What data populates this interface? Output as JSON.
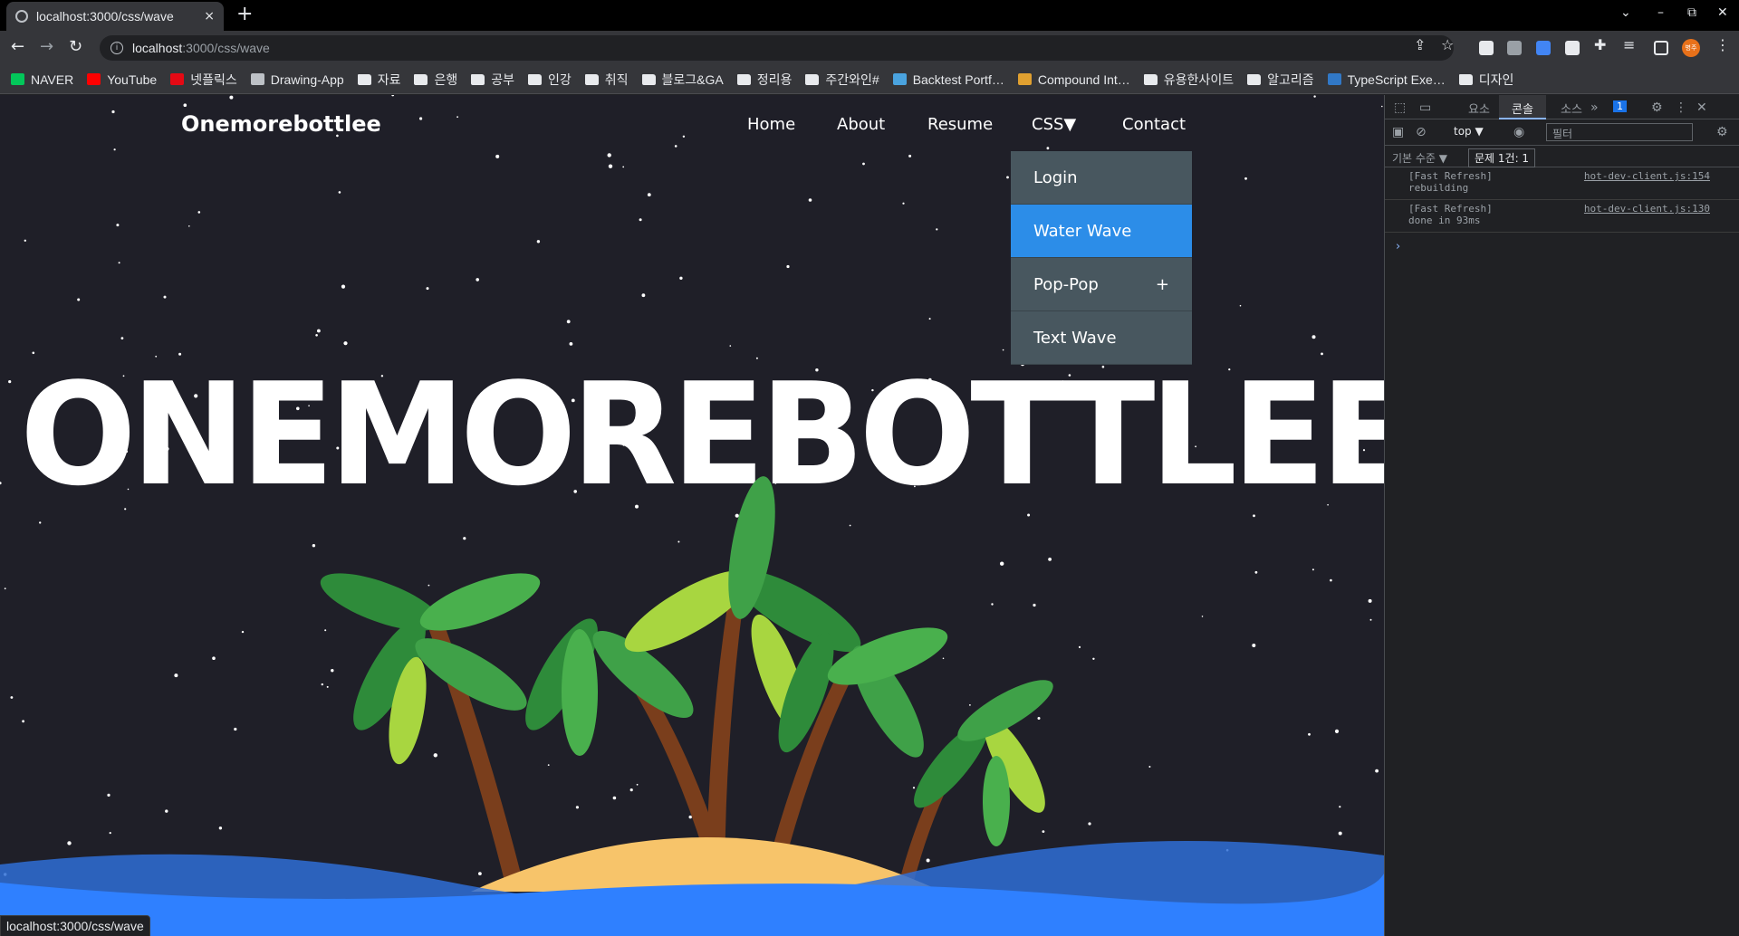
{
  "browser": {
    "tab_title": "localhost:3000/css/wave",
    "tab_close": "×",
    "new_tab": "+",
    "window_controls": [
      "⌄",
      "–",
      "⧉",
      "✕"
    ],
    "url_host": "localhost",
    "url_path": ":3000/css/wave",
    "status_url": "localhost:3000/css/wave"
  },
  "bookmarks": [
    {
      "label": "NAVER",
      "icon": "naver-icon",
      "color": "#03c75a"
    },
    {
      "label": "YouTube",
      "icon": "youtube-icon",
      "color": "#ff0000"
    },
    {
      "label": "넷플릭스",
      "icon": "netflix-icon",
      "color": "#e50914"
    },
    {
      "label": "Drawing-App",
      "icon": "globe-icon",
      "color": "#bdc1c6"
    },
    {
      "label": "자료",
      "icon": "folder-icon"
    },
    {
      "label": "은행",
      "icon": "folder-icon"
    },
    {
      "label": "공부",
      "icon": "folder-icon"
    },
    {
      "label": "인강",
      "icon": "folder-icon"
    },
    {
      "label": "취직",
      "icon": "folder-icon"
    },
    {
      "label": "블로그&GA",
      "icon": "folder-icon"
    },
    {
      "label": "정리용",
      "icon": "folder-icon"
    },
    {
      "label": "주간와인#",
      "icon": "folder-icon"
    },
    {
      "label": "Backtest Portf…",
      "icon": "site-icon",
      "color": "#4aa3df"
    },
    {
      "label": "Compound Int…",
      "icon": "site-icon",
      "color": "#e0a030"
    },
    {
      "label": "유용한사이트",
      "icon": "folder-icon"
    },
    {
      "label": "알고리즘",
      "icon": "folder-icon"
    },
    {
      "label": "TypeScript Exe…",
      "icon": "typescript-icon",
      "color": "#3178c6"
    },
    {
      "label": "디자인",
      "icon": "folder-icon"
    }
  ],
  "site": {
    "logo": "Onemorebottlee",
    "nav": [
      "Home",
      "About",
      "Resume",
      "CSS▼",
      "Contact"
    ],
    "dropdown": [
      {
        "label": "Login",
        "extra": ""
      },
      {
        "label": "Water Wave",
        "extra": ""
      },
      {
        "label": "Pop-Pop",
        "extra": "+"
      },
      {
        "label": "Text Wave",
        "extra": ""
      }
    ],
    "hero": "ONEMOREBOTTLEE",
    "colors": {
      "background": "#1f1f28",
      "active_item": "#2c8de8",
      "dropdown": "#48575f",
      "sea": "#2f80ff",
      "sand": "#f7c46a"
    }
  },
  "devtools": {
    "tabs": [
      "요소",
      "콘솔",
      "소스"
    ],
    "active_tab": "콘솔",
    "badge": "1",
    "context": "top ▼",
    "filter_placeholder": "필터",
    "levels": "기본 수준 ▼",
    "issues": "문제 1건: 1",
    "logs": [
      {
        "message": "[Fast Refresh] rebuilding",
        "source": "hot-dev-client.js:154"
      },
      {
        "message": "[Fast Refresh] done in 93ms",
        "source": "hot-dev-client.js:130"
      }
    ],
    "prompt": "›"
  }
}
